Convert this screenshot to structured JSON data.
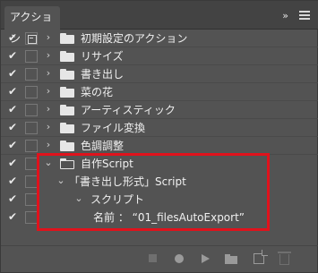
{
  "panel": {
    "tab_title": "アクション",
    "expand_glyph": "»"
  },
  "rows": [
    {
      "label": "初期設定のアクション",
      "checked": true,
      "dialog": true
    },
    {
      "label": "リサイズ",
      "checked": true,
      "dialog": false
    },
    {
      "label": "書き出し",
      "checked": true,
      "dialog": false
    },
    {
      "label": "菜の花",
      "checked": true,
      "dialog": false
    },
    {
      "label": "アーティスティック",
      "checked": true,
      "dialog": false
    },
    {
      "label": "ファイル変換",
      "checked": true,
      "dialog": false
    },
    {
      "label": "色調調整",
      "checked": true,
      "dialog": false
    },
    {
      "label": "自作Script",
      "checked": true,
      "dialog": false
    },
    {
      "label": "「書き出し形式」Script",
      "checked": true,
      "dialog": false
    },
    {
      "label": "スクリプト",
      "checked": true,
      "dialog": false
    },
    {
      "label": "名前 ： “01_filesAutoExport”",
      "checked": true,
      "dialog": false
    }
  ],
  "glyphs": {
    "check": "✔",
    "chevron_right": "›",
    "chevron_down": "⌄"
  },
  "colors": {
    "panel_bg": "#535353",
    "header_bg": "#434343",
    "highlight": "#e0121c"
  },
  "footer_icons": [
    "stop-icon",
    "record-icon",
    "play-icon",
    "new-set-folder-icon",
    "new-action-icon",
    "trash-icon"
  ]
}
